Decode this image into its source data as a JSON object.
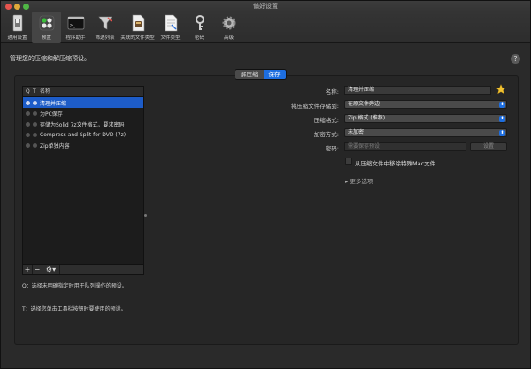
{
  "window": {
    "title": "偏好设置"
  },
  "toolbar": {
    "items": [
      {
        "label": "通用设置",
        "icon": "switch-icon"
      },
      {
        "label": "预置",
        "icon": "presets-icon",
        "selected": true
      },
      {
        "label": "程序助手",
        "icon": "terminal-icon"
      },
      {
        "label": "筛选列表",
        "icon": "filter-icon"
      },
      {
        "label": "关联的文件类型",
        "icon": "archive-file-icon"
      },
      {
        "label": "文件类型",
        "icon": "document-icon"
      },
      {
        "label": "密码",
        "icon": "key-icon"
      },
      {
        "label": "高级",
        "icon": "gear-icon"
      }
    ]
  },
  "header": {
    "hint": "管理您的压缩和解压缩预设。",
    "help": "?"
  },
  "segments": {
    "extract": "解压缩",
    "save": "保存",
    "selected": "save"
  },
  "list": {
    "col_q": "Q",
    "col_t": "T",
    "col_name": "名称",
    "rows": [
      {
        "name": "清理并压缩",
        "selected": true
      },
      {
        "name": "为PC保存",
        "selected": false
      },
      {
        "name": "存储为Solid 7z文件格式，要求密码",
        "selected": false
      },
      {
        "name": "Compress and Split for DVD (7z)",
        "selected": false
      },
      {
        "name": "Zip单独内容",
        "selected": false
      }
    ],
    "add": "+",
    "remove": "−",
    "gear": "⚙▾"
  },
  "descriptions": {
    "q": "Q：选择未明确指定时用于队列操作的预设。",
    "t": "T：选择您单击工具栏按钮时要使用的预设。"
  },
  "form": {
    "name_label": "名称:",
    "name_value": "清理并压缩",
    "save_to_label": "将压缩文件存储到:",
    "save_to_value": "在原文件旁边",
    "format_label": "压缩格式:",
    "format_value": "Zip 格式 (推荐)",
    "encrypt_label": "加密方式:",
    "encrypt_value": "未加密",
    "password_label": "密码:",
    "password_placeholder": "需要保存预设",
    "set_button": "设置",
    "remove_mac_label": "从压缩文件中移除特殊Mac文件",
    "more_options": "▸ 更多选项"
  },
  "colors": {
    "accent": "#1d6ee0",
    "selection": "#1d5cc8",
    "star": "#f1c232"
  }
}
